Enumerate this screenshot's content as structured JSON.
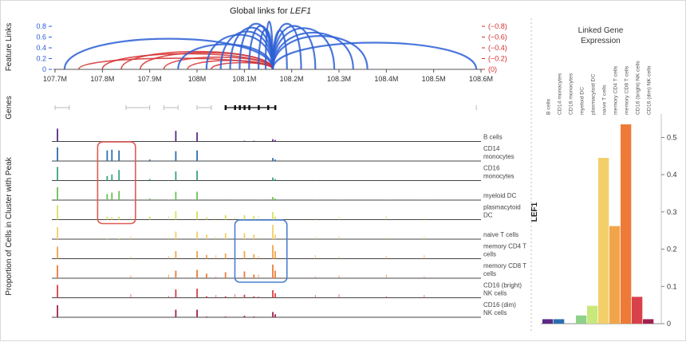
{
  "title_prefix": "Global links for",
  "gene": "LEF1",
  "left_panel": {
    "feature_links_label": "Feature Links",
    "genes_label": "Genes",
    "proportion_label": "Proportion of Cells in Cluster with Peak",
    "x_ticks": [
      "107.7M",
      "107.8M",
      "107.9M",
      "108M",
      "108.1M",
      "108.2M",
      "108.3M",
      "108.4M",
      "108.5M",
      "108.6M"
    ],
    "x_tick_values": [
      107.7,
      107.8,
      107.9,
      108.0,
      108.1,
      108.2,
      108.3,
      108.4,
      108.5,
      108.6
    ],
    "xlim": [
      107.7,
      108.6
    ],
    "pos_ticks": [
      "0.8",
      "0.6",
      "0.4",
      "0.2",
      "0"
    ],
    "neg_ticks": [
      "(−0.8)",
      "(−0.6)",
      "(−0.4)",
      "(−0.2)",
      "(0)"
    ],
    "pos_color": "#2b5fd6",
    "neg_color": "#d62f2f",
    "tracks": [
      {
        "label": [
          "B cells"
        ],
        "color": "#5b2a86"
      },
      {
        "label": [
          "CD14",
          "monocytes"
        ],
        "color": "#2c6fb0"
      },
      {
        "label": [
          "CD16",
          "monocytes"
        ],
        "color": "#3aa37a"
      },
      {
        "label": [
          "myeloid DC"
        ],
        "color": "#6cbf55"
      },
      {
        "label": [
          "plasmacytoid",
          "DC"
        ],
        "color": "#d8e060"
      },
      {
        "label": [
          "naive T cells"
        ],
        "color": "#f3cf6a"
      },
      {
        "label": [
          "memory CD4 T",
          "cells"
        ],
        "color": "#f2a44a"
      },
      {
        "label": [
          "memory CD8 T",
          "cells"
        ],
        "color": "#ee7a38"
      },
      {
        "label": [
          "CD16 (bright)",
          "NK cells"
        ],
        "color": "#d9414a"
      },
      {
        "label": [
          "CD16 (dim)",
          "NK cells"
        ],
        "color": "#a0214f"
      }
    ]
  },
  "right_panel": {
    "title_line1": "Linked Gene",
    "title_line2": "Expression",
    "y_axis_label": "LEF1",
    "y_ticks": [
      "0.5",
      "0.4",
      "0.3",
      "0.2",
      "0.1",
      "0"
    ]
  },
  "chart_data": [
    {
      "type": "arc",
      "title": "Global links for LEF1",
      "ylabel": "Feature Links",
      "xlim": [
        107.7,
        108.6
      ],
      "ylim_positive": [
        0,
        0.8
      ],
      "ylim_negative": [
        0,
        -0.8
      ],
      "links_positive": [
        {
          "from": 107.72,
          "to": 108.16,
          "score": 0.55
        },
        {
          "from": 107.96,
          "to": 108.16,
          "score": 0.45
        },
        {
          "from": 108.02,
          "to": 108.16,
          "score": 0.62
        },
        {
          "from": 108.05,
          "to": 108.16,
          "score": 0.68
        },
        {
          "from": 108.07,
          "to": 108.16,
          "score": 0.75
        },
        {
          "from": 108.09,
          "to": 108.16,
          "score": 0.82
        },
        {
          "from": 108.11,
          "to": 108.16,
          "score": 0.78
        },
        {
          "from": 108.13,
          "to": 108.16,
          "score": 0.72
        },
        {
          "from": 108.145,
          "to": 108.16,
          "score": 0.86
        },
        {
          "from": 108.16,
          "to": 108.19,
          "score": 0.7
        },
        {
          "from": 108.16,
          "to": 108.22,
          "score": 0.82
        },
        {
          "from": 108.16,
          "to": 108.25,
          "score": 0.78
        },
        {
          "from": 108.16,
          "to": 108.29,
          "score": 0.74
        },
        {
          "from": 108.16,
          "to": 108.33,
          "score": 0.66
        },
        {
          "from": 108.16,
          "to": 108.36,
          "score": 0.6
        },
        {
          "from": 108.16,
          "to": 108.59,
          "score": 0.48
        }
      ],
      "links_negative": [
        {
          "from": 107.75,
          "to": 108.16,
          "score": -0.2
        },
        {
          "from": 107.8,
          "to": 108.16,
          "score": -0.28
        },
        {
          "from": 107.84,
          "to": 108.16,
          "score": -0.32
        },
        {
          "from": 107.88,
          "to": 108.16,
          "score": -0.3
        },
        {
          "from": 107.93,
          "to": 108.16,
          "score": -0.22
        },
        {
          "from": 107.98,
          "to": 108.16,
          "score": -0.16
        },
        {
          "from": 108.03,
          "to": 108.16,
          "score": -0.12
        }
      ]
    },
    {
      "type": "coverage",
      "ylabel": "Proportion of Cells in Cluster with Peak",
      "xlim": [
        107.7,
        108.6
      ],
      "positions": [
        107.705,
        107.81,
        107.82,
        107.835,
        107.9,
        107.955,
        108.0,
        108.02,
        108.06,
        108.1,
        108.12,
        108.16,
        108.165
      ],
      "series": [
        {
          "name": "B cells",
          "values": [
            0.85,
            0,
            0,
            0,
            0,
            0.7,
            0.6,
            0,
            0,
            0.05,
            0.05,
            0.15,
            0.1
          ]
        },
        {
          "name": "CD14 monocytes",
          "values": [
            0.9,
            0.7,
            0.75,
            0.7,
            0.1,
            0.65,
            0.7,
            0,
            0,
            0,
            0,
            0.2,
            0.1
          ]
        },
        {
          "name": "CD16 monocytes",
          "values": [
            0.9,
            0.3,
            0.4,
            0.7,
            0.1,
            0.6,
            0.65,
            0,
            0,
            0,
            0,
            0.2,
            0.1
          ]
        },
        {
          "name": "myeloid DC",
          "values": [
            0.85,
            0.4,
            0.5,
            0.6,
            0.1,
            0.55,
            0.55,
            0,
            0,
            0,
            0,
            0.2,
            0.1
          ]
        },
        {
          "name": "plasmacytoid DC",
          "values": [
            0.95,
            0.2,
            0.15,
            0.2,
            0.2,
            0.55,
            0.55,
            0.15,
            0.3,
            0.3,
            0.25,
            0.5,
            0.2
          ]
        },
        {
          "name": "naive T cells",
          "values": [
            0.8,
            0.05,
            0,
            0.05,
            0,
            0.5,
            0.5,
            0.3,
            0.4,
            0.4,
            0.3,
            0.95,
            0.3
          ]
        },
        {
          "name": "memory CD4 T cells",
          "values": [
            0.8,
            0,
            0,
            0,
            0,
            0.5,
            0.5,
            0.25,
            0.35,
            0.5,
            0.3,
            0.9,
            0.5
          ]
        },
        {
          "name": "memory CD8 T cells",
          "values": [
            0.85,
            0,
            0,
            0,
            0,
            0.5,
            0.55,
            0.3,
            0.4,
            0.45,
            0.25,
            0.9,
            0.5
          ]
        },
        {
          "name": "CD16 (bright) NK cells",
          "values": [
            0.85,
            0,
            0,
            0,
            0,
            0.55,
            0.6,
            0.1,
            0.1,
            0.2,
            0.1,
            0.5,
            0.3
          ]
        },
        {
          "name": "CD16 (dim) NK cells",
          "values": [
            0.8,
            0,
            0,
            0,
            0,
            0.5,
            0.5,
            0.05,
            0.05,
            0.1,
            0.05,
            0.35,
            0.2
          ]
        }
      ],
      "highlight_boxes": [
        {
          "color": "#e05a52",
          "x_range": [
            107.79,
            107.87
          ],
          "tracks": [
            "CD14 monocytes",
            "plasmacytoid DC"
          ]
        },
        {
          "color": "#4a7fd1",
          "x_range": [
            108.08,
            108.19
          ],
          "tracks": [
            "naive T cells",
            "memory CD8 T cells"
          ]
        }
      ]
    },
    {
      "type": "bar",
      "title": "Linked Gene Expression",
      "ylabel": "LEF1",
      "ylim": [
        0,
        0.55
      ],
      "categories": [
        "B cells",
        "CD14 monocytes",
        "CD16 monocytes",
        "myeloid DC",
        "plasmacytoid DC",
        "naive T cells",
        "memory CD4 T cells",
        "memory CD8 T cells",
        "CD16 (bright) NK cells",
        "CD16 (dim) NK cells"
      ],
      "values": [
        0.012,
        0.012,
        0.0,
        0.022,
        0.048,
        0.445,
        0.262,
        0.535,
        0.072,
        0.012
      ],
      "colors": [
        "#5b2a86",
        "#2c6fb0",
        "#3aa37a",
        "#8fd08a",
        "#c8e87a",
        "#f3cf6a",
        "#f2a44a",
        "#ee7a38",
        "#d9414a",
        "#a0214f"
      ]
    }
  ]
}
